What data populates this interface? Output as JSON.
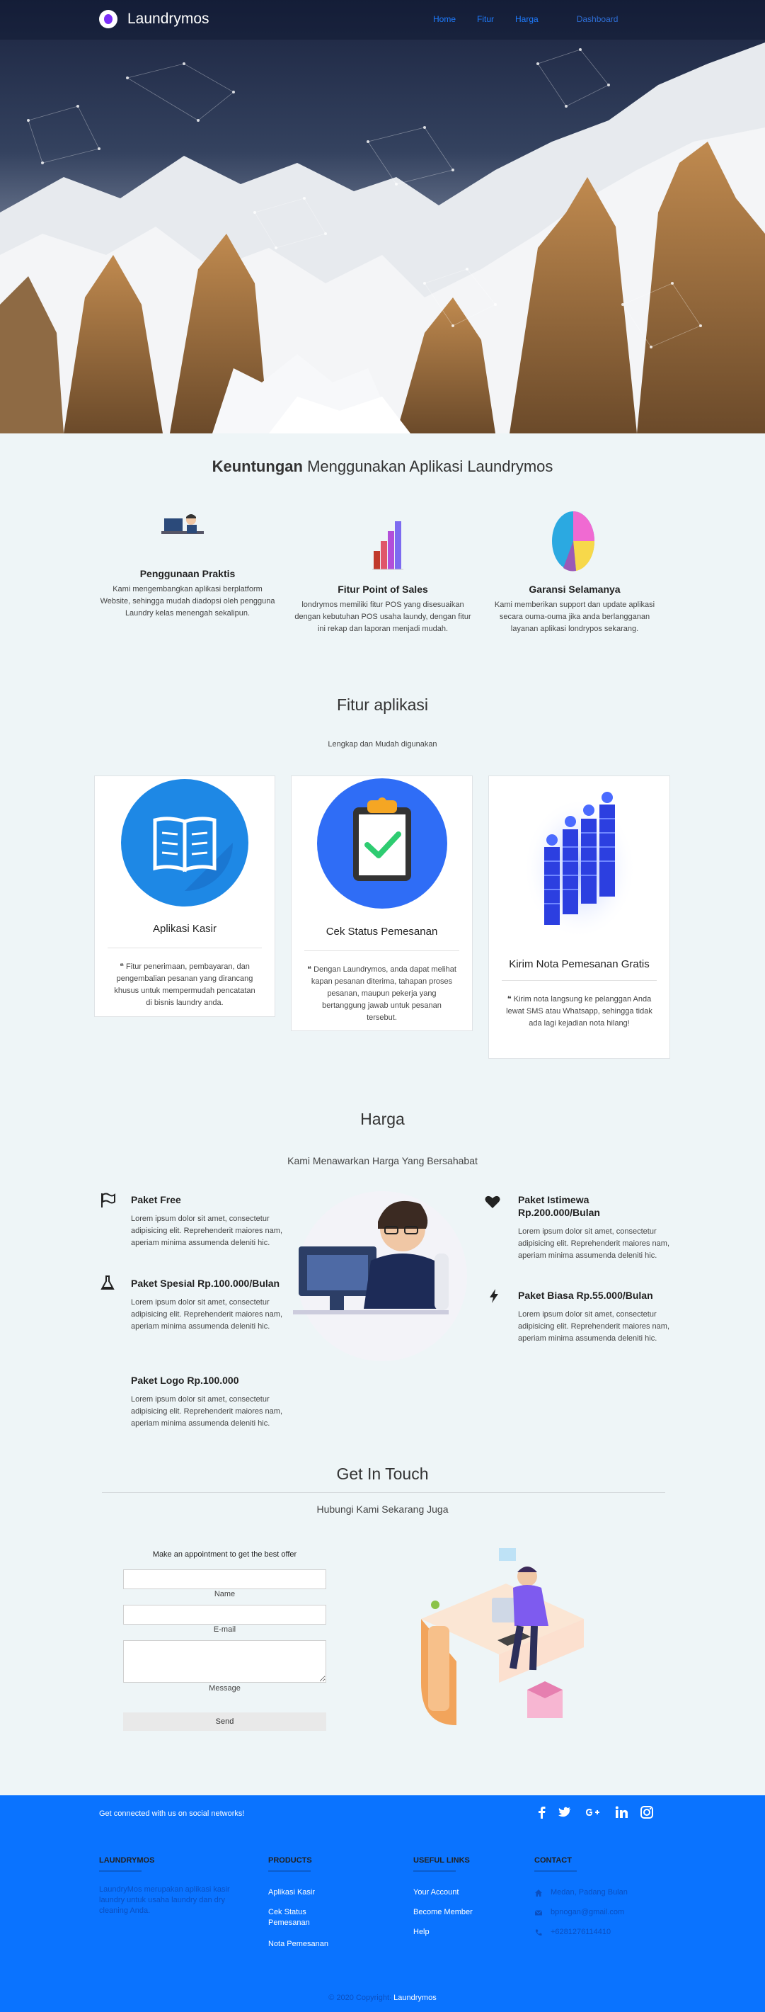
{
  "nav": {
    "brand": "Laundrymos",
    "links": [
      "Home",
      "Fitur",
      "Harga",
      "Dashboard"
    ]
  },
  "benefits": {
    "title_bold": "Keuntungan",
    "title_rest": "Menggunakan Aplikasi Laundrymos",
    "items": [
      {
        "title": "Penggunaan Praktis",
        "text": "Kami mengembangkan aplikasi berplatform Website, sehingga mudah diadopsi oleh pengguna Laundry kelas menengah sekalipun."
      },
      {
        "title": "Fitur Point of Sales",
        "text": "londrymos memiliki fitur POS yang disesuaikan dengan kebutuhan POS usaha laundy, dengan fitur ini rekap dan laporan menjadi mudah."
      },
      {
        "title": "Garansi Selamanya",
        "text": "Kami memberikan support dan update aplikasi secara ouma-ouma jika anda berlangganan layanan aplikasi londrypos sekarang."
      }
    ]
  },
  "features": {
    "title": "Fitur aplikasi",
    "subtitle": "Lengkap dan Mudah digunakan",
    "cards": [
      {
        "title": "Aplikasi Kasir",
        "text": "❝ Fitur penerimaan, pembayaran, dan pengembalian pesanan yang dirancang khusus untuk mempermudah pencatatan di bisnis laundry anda."
      },
      {
        "title": "Cek Status Pemesanan",
        "text": "❝ Dengan Laundrymos, anda dapat melihat kapan pesanan diterima, tahapan proses pesanan, maupun pekerja yang bertanggung jawab untuk pesanan tersebut."
      },
      {
        "title": "Kirim Nota Pemesanan Gratis",
        "text": "❝ Kirim nota langsung ke pelanggan Anda lewat SMS atau Whatsapp, sehingga tidak ada lagi kejadian nota hilang!"
      }
    ]
  },
  "pricing": {
    "title": "Harga",
    "subtitle": "Kami Menawarkan Harga Yang Bersahabat",
    "plans": [
      {
        "name": "Paket Free",
        "text": "Lorem ipsum dolor sit amet, consectetur adipisicing elit. Reprehenderit maiores nam, aperiam minima assumenda deleniti hic.",
        "icon": "flag-icon"
      },
      {
        "name": "Paket Spesial Rp.100.000/Bulan",
        "text": "Lorem ipsum dolor sit amet, consectetur adipisicing elit. Reprehenderit maiores nam, aperiam minima assumenda deleniti hic.",
        "icon": "flask-icon"
      },
      {
        "name": "Paket Logo Rp.100.000",
        "text": "Lorem ipsum dolor sit amet, consectetur adipisicing elit. Reprehenderit maiores nam, aperiam minima assumenda deleniti hic.",
        "icon": ""
      },
      {
        "name": "Paket Istimewa Rp.200.000/Bulan",
        "text": "Lorem ipsum dolor sit amet, consectetur adipisicing elit. Reprehenderit maiores nam, aperiam minima assumenda deleniti hic.",
        "icon": "heart-icon"
      },
      {
        "name": "Paket Biasa Rp.55.000/Bulan",
        "text": "Lorem ipsum dolor sit amet, consectetur adipisicing elit. Reprehenderit maiores nam, aperiam minima assumenda deleniti hic.",
        "icon": "bolt-icon"
      }
    ]
  },
  "contact": {
    "title": "Get In Touch",
    "subtitle": "Hubungi Kami Sekarang Juga",
    "form_heading": "Make an appointment to get the best offer",
    "name_label": "Name",
    "email_label": "E-mail",
    "message_label": "Message",
    "send_label": "Send"
  },
  "footer": {
    "social_text": "Get connected with us on social networks!",
    "social_icons": [
      "facebook-icon",
      "twitter-icon",
      "google-plus-icon",
      "linkedin-icon",
      "instagram-icon"
    ],
    "col1_head": "LAUNDRYMOS",
    "col1_text": "LaundryMos merupakan aplikasi kasir laundry untuk usaha laundry dan dry cleaning Anda.",
    "col2_head": "PRODUCTS",
    "col2_links": [
      "Aplikasi Kasir",
      "Cek Status Pemesanan",
      "Nota Pemesanan"
    ],
    "col3_head": "USEFUL LINKS",
    "col3_links": [
      "Your Account",
      "Become Member",
      "Help"
    ],
    "col4_head": "CONTACT",
    "col4_items": [
      "Medan, Padang Bulan",
      "bpnogan@gmail.com",
      "+6281276114410"
    ],
    "copyright_prefix": "© 2020 Copyright:",
    "copyright_brand": "Laundrymos"
  },
  "colors": {
    "accent": "#0a73ff",
    "nav_link": "#1e7bff",
    "background": "#eef5f7"
  }
}
